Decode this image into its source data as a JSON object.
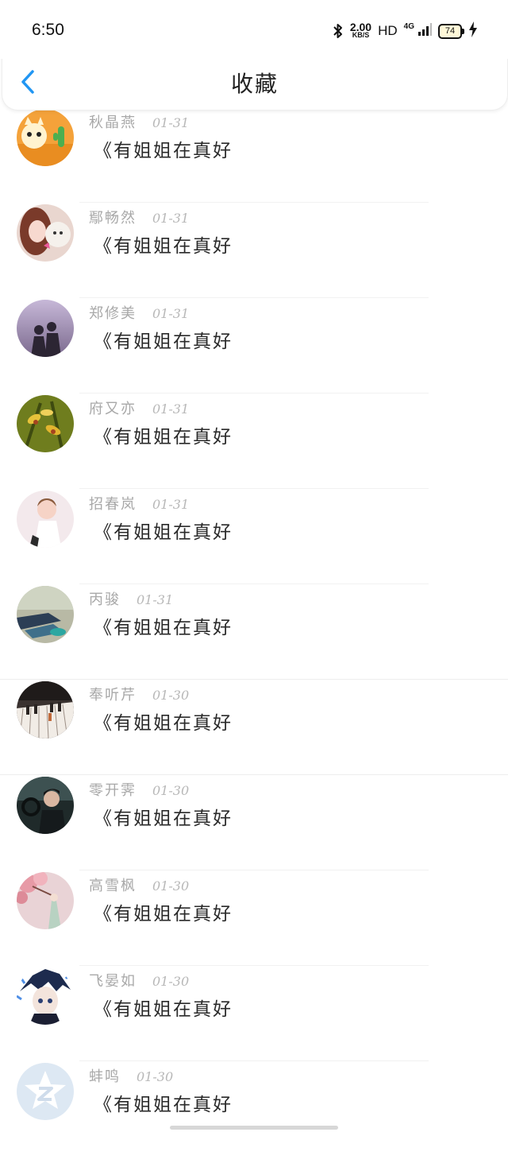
{
  "status_bar": {
    "time": "6:50",
    "speed_value": "2.00",
    "speed_unit": "KB/S",
    "hd": "HD",
    "network": "4G",
    "battery": "74"
  },
  "header": {
    "title": "收藏",
    "back_icon": "chevron-left-icon",
    "accent_color": "#2196f3"
  },
  "items": [
    {
      "name": "秋晶燕",
      "date": "01-31",
      "content": "《有姐姐在真好",
      "avatar": "cartoon-cat-avatar"
    },
    {
      "name": "鄢畅然",
      "date": "01-31",
      "content": "《有姐姐在真好",
      "avatar": "girl-with-dog-avatar"
    },
    {
      "name": "郑修美",
      "date": "01-31",
      "content": "《有姐姐在真好",
      "avatar": "couple-silhouette-avatar"
    },
    {
      "name": "府又亦",
      "date": "01-31",
      "content": "《有姐姐在真好",
      "avatar": "orchid-flowers-avatar"
    },
    {
      "name": "招春岚",
      "date": "01-31",
      "content": "《有姐姐在真好",
      "avatar": "child-avatar"
    },
    {
      "name": "丙骏",
      "date": "01-31",
      "content": "《有姐姐在真好",
      "avatar": "shoes-avatar"
    },
    {
      "name": "奉听芹",
      "date": "01-30",
      "content": "《有姐姐在真好",
      "avatar": "piano-keys-avatar"
    },
    {
      "name": "零开霁",
      "date": "01-30",
      "content": "《有姐姐在真好",
      "avatar": "man-in-car-avatar"
    },
    {
      "name": "高雪枫",
      "date": "01-30",
      "content": "《有姐姐在真好",
      "avatar": "blossom-avatar"
    },
    {
      "name": "飞晏如",
      "date": "01-30",
      "content": "《有姐姐在真好",
      "avatar": "anime-boy-avatar"
    },
    {
      "name": "蚌鸣",
      "date": "01-30",
      "content": "《有姐姐在真好",
      "avatar": "default-qzone-avatar"
    }
  ]
}
